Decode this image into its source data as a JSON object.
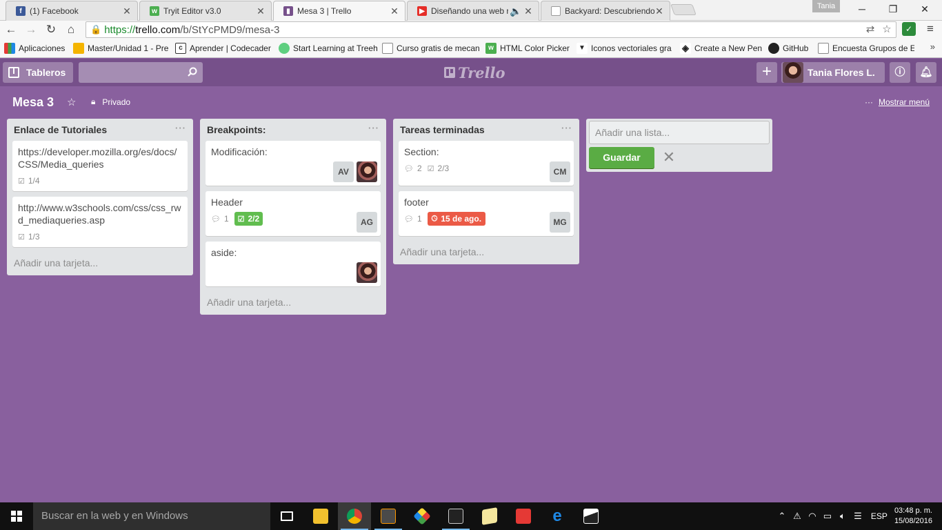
{
  "browser": {
    "tabs": [
      {
        "title": "(1) Facebook",
        "icon": "facebook-icon",
        "color": "#3b5998"
      },
      {
        "title": "Tryit Editor v3.0",
        "icon": "w3schools-icon",
        "color": "#4caf50"
      },
      {
        "title": "Mesa 3 | Trello",
        "icon": "trello-icon",
        "color": "#76508a"
      },
      {
        "title": "Diseñando una web re",
        "icon": "youtube-icon",
        "color": "#e52d27"
      },
      {
        "title": "Backyard: Descubriendo B",
        "icon": "page-icon",
        "color": "#9e9e9e"
      }
    ],
    "profile_name": "Tania",
    "url_scheme": "https://",
    "url_host": "trello.com",
    "url_path": "/b/StYcPMD9/mesa-3",
    "bookmarks": [
      {
        "label": "Aplicaciones",
        "icon": "apps-grid-icon"
      },
      {
        "label": "Master/Unidad 1 - Pre",
        "icon": "folder-icon"
      },
      {
        "label": "Aprender | Codecader",
        "icon": "codecademy-icon"
      },
      {
        "label": "Start Learning at Treeh",
        "icon": "treehouse-icon"
      },
      {
        "label": "Curso gratis de mecan",
        "icon": "page-icon"
      },
      {
        "label": "HTML Color Picker",
        "icon": "w3schools-icon"
      },
      {
        "label": "Iconos vectoriales gra",
        "icon": "freepik-icon"
      },
      {
        "label": "Create a New Pen",
        "icon": "codepen-icon"
      },
      {
        "label": "GitHub",
        "icon": "github-icon"
      },
      {
        "label": "Encuesta Grupos de E",
        "icon": "page-icon"
      }
    ]
  },
  "trello": {
    "boards_label": "Tableros",
    "logo_text": "Trello",
    "user_name": "Tania Flores L.",
    "board_name": "Mesa 3",
    "privacy_label": "Privado",
    "show_menu_label": "Mostrar menú",
    "lists": [
      {
        "name": "Enlace de Tutoriales",
        "add_card": "Añadir una tarjeta...",
        "cards": [
          {
            "title": "https://developer.mozilla.org/es/docs/CSS/Media_queries",
            "checklist": "1/4"
          },
          {
            "title": "http://www.w3schools.com/css/css_rwd_mediaqueries.asp",
            "checklist": "1/3"
          }
        ]
      },
      {
        "name": "Breakpoints:",
        "add_card": "Añadir una tarjeta...",
        "cards": [
          {
            "title": "Modificación:",
            "members": [
              "AV"
            ]
          },
          {
            "title": "Header",
            "comments": "1",
            "checklist_done": "2/2",
            "members": [
              "AG"
            ]
          },
          {
            "title": "aside:"
          }
        ]
      },
      {
        "name": "Tareas terminadas",
        "add_card": "Añadir una tarjeta...",
        "cards": [
          {
            "title": "Section:",
            "comments": "2",
            "checklist": "2/3",
            "members": [
              "CM"
            ]
          },
          {
            "title": "footer",
            "comments": "1",
            "due": "15 de ago.",
            "members": [
              "MG"
            ]
          }
        ]
      }
    ],
    "add_list": {
      "placeholder": "Añadir una lista...",
      "save_label": "Guardar"
    }
  },
  "taskbar": {
    "search_placeholder": "Buscar en la web y en Windows",
    "language": "ESP",
    "time": "03:48 p. m.",
    "date": "15/08/2016"
  }
}
